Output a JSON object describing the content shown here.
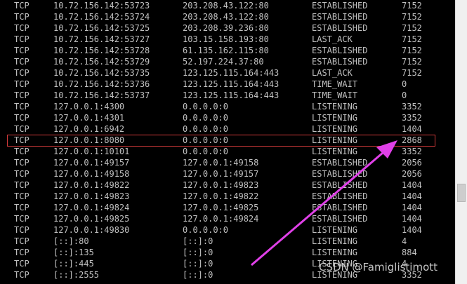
{
  "console": {
    "rows": [
      [
        "TCP",
        "10.72.156.142:53723",
        "203.208.43.122:80",
        "ESTABLISHED",
        "7152"
      ],
      [
        "TCP",
        "10.72.156.142:53724",
        "203.208.43.122:80",
        "ESTABLISHED",
        "7152"
      ],
      [
        "TCP",
        "10.72.156.142:53725",
        "203.208.39.236:80",
        "ESTABLISHED",
        "7152"
      ],
      [
        "TCP",
        "10.72.156.142:53727",
        "103.15.158.193:80",
        "LAST_ACK",
        "7152"
      ],
      [
        "TCP",
        "10.72.156.142:53728",
        "61.135.162.115:80",
        "ESTABLISHED",
        "7152"
      ],
      [
        "TCP",
        "10.72.156.142:53729",
        "52.197.224.37:80",
        "ESTABLISHED",
        "7152"
      ],
      [
        "TCP",
        "10.72.156.142:53735",
        "123.125.115.164:443",
        "LAST_ACK",
        "7152"
      ],
      [
        "TCP",
        "10.72.156.142:53736",
        "123.125.115.164:443",
        "TIME_WAIT",
        "0"
      ],
      [
        "TCP",
        "10.72.156.142:53737",
        "123.125.115.164:443",
        "TIME_WAIT",
        "0"
      ],
      [
        "TCP",
        "127.0.0.1:4300",
        "0.0.0.0:0",
        "LISTENING",
        "3352"
      ],
      [
        "TCP",
        "127.0.0.1:4301",
        "0.0.0.0:0",
        "LISTENING",
        "3352"
      ],
      [
        "TCP",
        "127.0.0.1:6942",
        "0.0.0.0:0",
        "LISTENING",
        "1404"
      ],
      [
        "TCP",
        "127.0.0.1:8080",
        "0.0.0.0:0",
        "LISTENING",
        "2868"
      ],
      [
        "TCP",
        "127.0.0.1:10101",
        "0.0.0.0:0",
        "LISTENING",
        "3352"
      ],
      [
        "TCP",
        "127.0.0.1:49157",
        "127.0.0.1:49158",
        "ESTABLISHED",
        "2056"
      ],
      [
        "TCP",
        "127.0.0.1:49158",
        "127.0.0.1:49157",
        "ESTABLISHED",
        "2056"
      ],
      [
        "TCP",
        "127.0.0.1:49822",
        "127.0.0.1:49823",
        "ESTABLISHED",
        "1404"
      ],
      [
        "TCP",
        "127.0.0.1:49823",
        "127.0.0.1:49822",
        "ESTABLISHED",
        "1404"
      ],
      [
        "TCP",
        "127.0.0.1:49824",
        "127.0.0.1:49825",
        "ESTABLISHED",
        "1404"
      ],
      [
        "TCP",
        "127.0.0.1:49825",
        "127.0.0.1:49824",
        "ESTABLISHED",
        "1404"
      ],
      [
        "TCP",
        "127.0.0.1:49830",
        "0.0.0.0:0",
        "LISTENING",
        "1404"
      ],
      [
        "TCP",
        "[::]:80",
        "[::]:0",
        "LISTENING",
        "4"
      ],
      [
        "TCP",
        "[::]:135",
        "[::]:0",
        "LISTENING",
        "884"
      ],
      [
        "TCP",
        "[::]:445",
        "[::]:0",
        "LISTENING",
        "4"
      ],
      [
        "TCP",
        "[::]:2555",
        "[::]:0",
        "LISTENING",
        "3352"
      ]
    ]
  },
  "annotation": {
    "highlight_color": "#d23a3a",
    "arrow_color": "#e040e8"
  },
  "watermark": {
    "text": "CSDN @Famiglistimott"
  }
}
